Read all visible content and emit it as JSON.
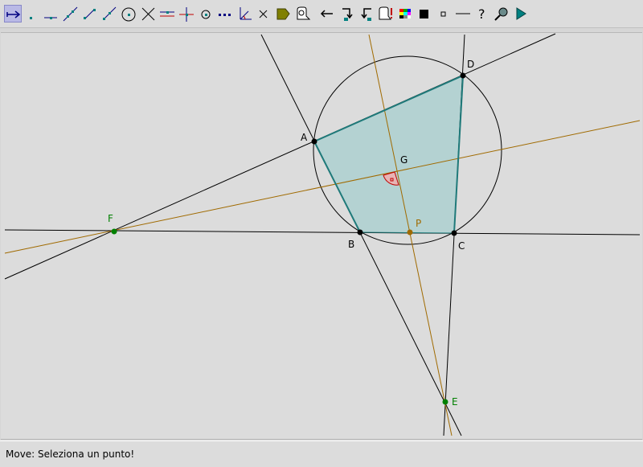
{
  "toolbar": {
    "tools": [
      {
        "name": "move-tool",
        "icon": "move-arrow-icon",
        "active": true
      },
      {
        "name": "point-tool",
        "icon": "point-icon"
      },
      {
        "name": "point-on-line-tool",
        "icon": "point-on-line-icon"
      },
      {
        "name": "line-tool",
        "icon": "line-icon"
      },
      {
        "name": "segment-tool",
        "icon": "segment-icon"
      },
      {
        "name": "ray-tool",
        "icon": "ray-icon"
      },
      {
        "name": "circle-tool",
        "icon": "circle-icon"
      },
      {
        "name": "intersection-tool",
        "icon": "intersection-icon"
      },
      {
        "name": "parallel-tool",
        "icon": "parallel-icon"
      },
      {
        "name": "perpendicular-tool",
        "icon": "perpendicular-icon"
      },
      {
        "name": "midpoint-tool",
        "icon": "midpoint-icon"
      },
      {
        "name": "dotted-line-tool",
        "icon": "dotted-line-icon"
      },
      {
        "name": "angle-tool",
        "icon": "angle-icon"
      },
      {
        "name": "delete-tool",
        "icon": "delete-x-icon"
      },
      {
        "name": "polygon-fill-tool",
        "icon": "polygon-fill-icon"
      },
      {
        "name": "macro-tool",
        "icon": "macro-icon"
      },
      {
        "name": "back-tool",
        "icon": "back-arrow-icon"
      },
      {
        "name": "step-forward-tool",
        "icon": "step-forward-icon"
      },
      {
        "name": "step-back-tool",
        "icon": "step-back-icon"
      },
      {
        "name": "warning-tool",
        "icon": "warning-icon"
      },
      {
        "name": "color-tool",
        "icon": "color-grid-icon"
      },
      {
        "name": "fill-black-tool",
        "icon": "black-square-icon"
      },
      {
        "name": "small-point-tool",
        "icon": "small-square-icon"
      },
      {
        "name": "line-style-tool",
        "icon": "line-style-icon"
      },
      {
        "name": "help-tool",
        "icon": "question-mark-icon"
      },
      {
        "name": "zoom-tool",
        "icon": "magnifier-icon"
      },
      {
        "name": "play-tool",
        "icon": "play-icon"
      }
    ]
  },
  "points": {
    "A": {
      "label": "A",
      "color": "#000000"
    },
    "B": {
      "label": "B",
      "color": "#000000"
    },
    "C": {
      "label": "C",
      "color": "#000000"
    },
    "D": {
      "label": "D",
      "color": "#000000"
    },
    "E": {
      "label": "E",
      "color": "#008000"
    },
    "F": {
      "label": "F",
      "color": "#008000"
    },
    "G": {
      "label": "G",
      "color": "#000000"
    },
    "P": {
      "label": "P",
      "color": "#a06a00"
    }
  },
  "colors": {
    "polygon_fill": "#b4d2d2",
    "polygon_edge": "#1f7a7a",
    "line": "#000000",
    "aux_line": "#a06a00",
    "angle_fill": "#e8a0a0",
    "angle_edge": "#c00000"
  },
  "status": {
    "text": "Move: Seleziona un punto!"
  }
}
